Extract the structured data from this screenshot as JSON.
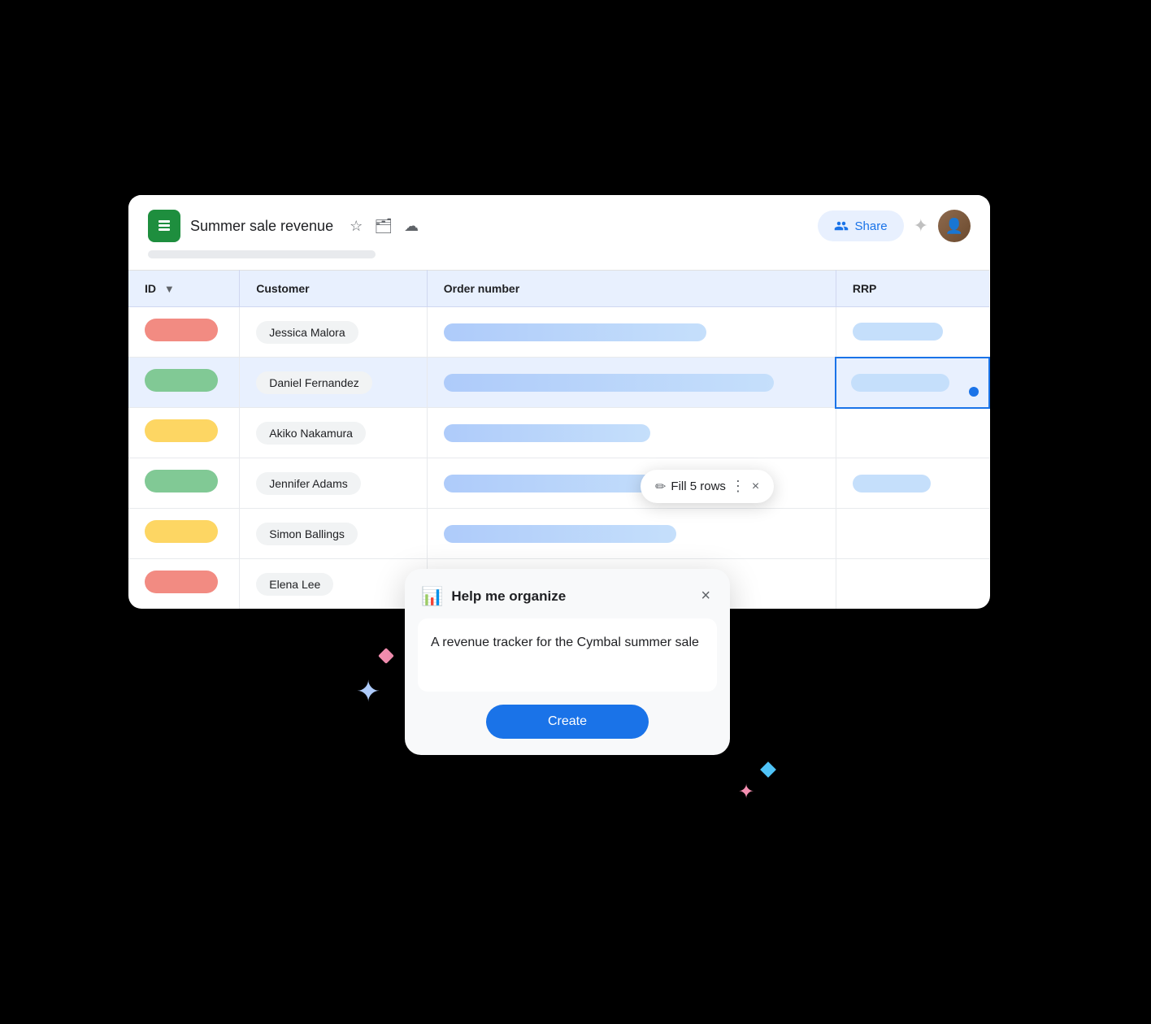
{
  "header": {
    "title": "Summer sale revenue",
    "share_label": "Share",
    "sparkle_symbol": "✦"
  },
  "table": {
    "columns": [
      "ID",
      "Customer",
      "Order number",
      "RRP"
    ],
    "rows": [
      {
        "id_color": "red",
        "customer": "Jessica Malora",
        "order_width": "70%",
        "rrp_width": "75%",
        "selected": false
      },
      {
        "id_color": "green",
        "customer": "Daniel Fernandez",
        "order_width": "88%",
        "rrp_width": "80%",
        "selected": true
      },
      {
        "id_color": "yellow",
        "customer": "Akiko Nakamura",
        "order_width": "55%",
        "rrp_width": "0%",
        "selected": false
      },
      {
        "id_color": "green",
        "customer": "Jennifer Adams",
        "order_width": "65%",
        "rrp_width": "65%",
        "selected": false
      },
      {
        "id_color": "yellow",
        "customer": "Simon Ballings",
        "order_width": "62%",
        "rrp_width": "0%",
        "selected": false
      },
      {
        "id_color": "red",
        "customer": "Elena Lee",
        "order_width": "35%",
        "rrp_width": "0%",
        "selected": false
      }
    ]
  },
  "fill_tooltip": {
    "label": "Fill 5 rows",
    "icon": "✏️"
  },
  "hmo_dialog": {
    "title": "Help me organize",
    "close_label": "×",
    "body_text": "A revenue tracker for the Cymbal summer sale",
    "create_label": "Create"
  },
  "sparkles": {
    "blue": "✦",
    "pink_diamond": "◆",
    "blue_small": "✦"
  }
}
